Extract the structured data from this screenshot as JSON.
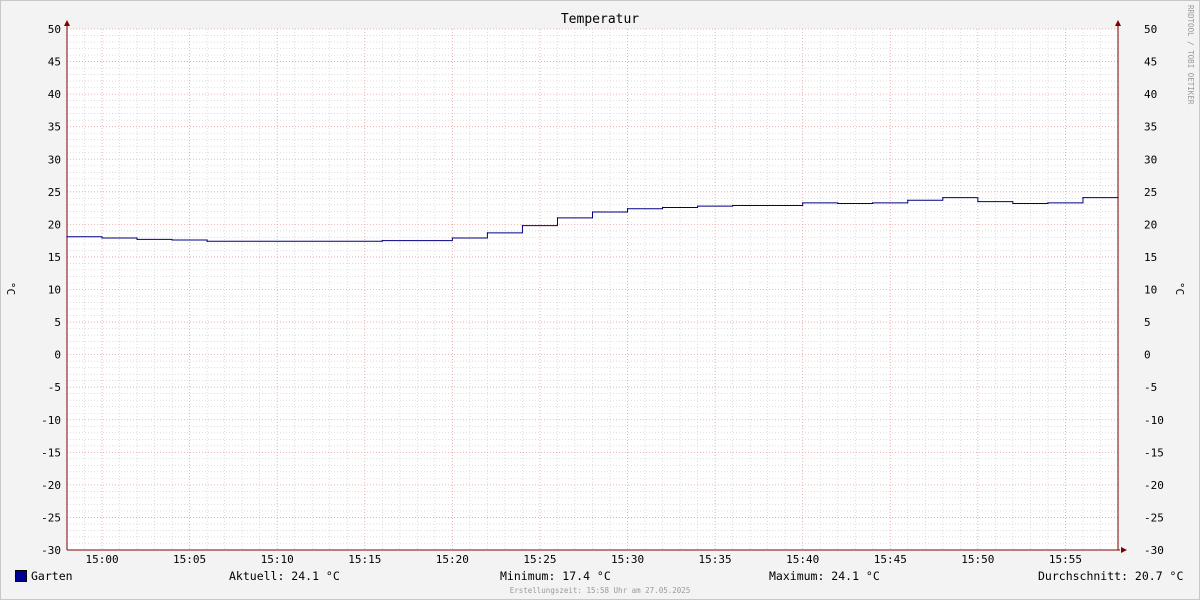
{
  "chart_data": {
    "type": "line",
    "title": "Temperatur",
    "ylabel": "°C",
    "xlabel": "",
    "ylim": [
      -30,
      50
    ],
    "yticks": [
      50,
      45,
      40,
      35,
      30,
      25,
      20,
      15,
      10,
      5,
      0,
      -5,
      -10,
      -15,
      -20,
      -25,
      -30
    ],
    "xrange": [
      "14:58",
      "15:58"
    ],
    "xticks": [
      "15:00",
      "15:05",
      "15:10",
      "15:15",
      "15:20",
      "15:25",
      "15:30",
      "15:35",
      "15:40",
      "15:45",
      "15:50",
      "15:55"
    ],
    "grid": true,
    "legend": "bottom-left",
    "series": [
      {
        "name": "Garten",
        "color": "#000080",
        "step": true,
        "points": [
          {
            "t": "14:58",
            "v": 18.1
          },
          {
            "t": "15:00",
            "v": 17.9
          },
          {
            "t": "15:02",
            "v": 17.7
          },
          {
            "t": "15:04",
            "v": 17.6
          },
          {
            "t": "15:06",
            "v": 17.4
          },
          {
            "t": "15:16",
            "v": 17.5
          },
          {
            "t": "15:20",
            "v": 17.9
          },
          {
            "t": "15:22",
            "v": 18.7
          },
          {
            "t": "15:24",
            "v": 19.8
          },
          {
            "t": "15:26",
            "v": 21.0
          },
          {
            "t": "15:28",
            "v": 21.9
          },
          {
            "t": "15:30",
            "v": 22.4
          },
          {
            "t": "15:32",
            "v": 22.6
          },
          {
            "t": "15:34",
            "v": 22.8
          },
          {
            "t": "15:36",
            "v": 22.9
          },
          {
            "t": "15:40",
            "v": 23.3
          },
          {
            "t": "15:42",
            "v": 23.2
          },
          {
            "t": "15:44",
            "v": 23.3
          },
          {
            "t": "15:46",
            "v": 23.7
          },
          {
            "t": "15:48",
            "v": 24.1
          },
          {
            "t": "15:50",
            "v": 23.5
          },
          {
            "t": "15:52",
            "v": 23.2
          },
          {
            "t": "15:54",
            "v": 23.3
          },
          {
            "t": "15:56",
            "v": 24.1
          },
          {
            "t": "15:58",
            "v": 24.1
          }
        ]
      }
    ],
    "colors": {
      "background": "#f3f3f3",
      "plot_area": "#ffffff",
      "major_grid": "#e6a0a0",
      "minor_grid": "#c8c8c8",
      "axis": "#800000"
    }
  },
  "stats": {
    "current": "Aktuell: 24.1 °C",
    "minimum": "Minimum: 17.4 °C",
    "maximum": "Maximum: 24.1 °C",
    "average": "Durchschnitt: 20.7 °C"
  },
  "legend": {
    "label": "Garten",
    "color": "#000096"
  },
  "watermark": "RRDTOOL / TOBI OETIKER",
  "footer": "Erstellungszeit: 15:58 Uhr am 27.05.2025"
}
